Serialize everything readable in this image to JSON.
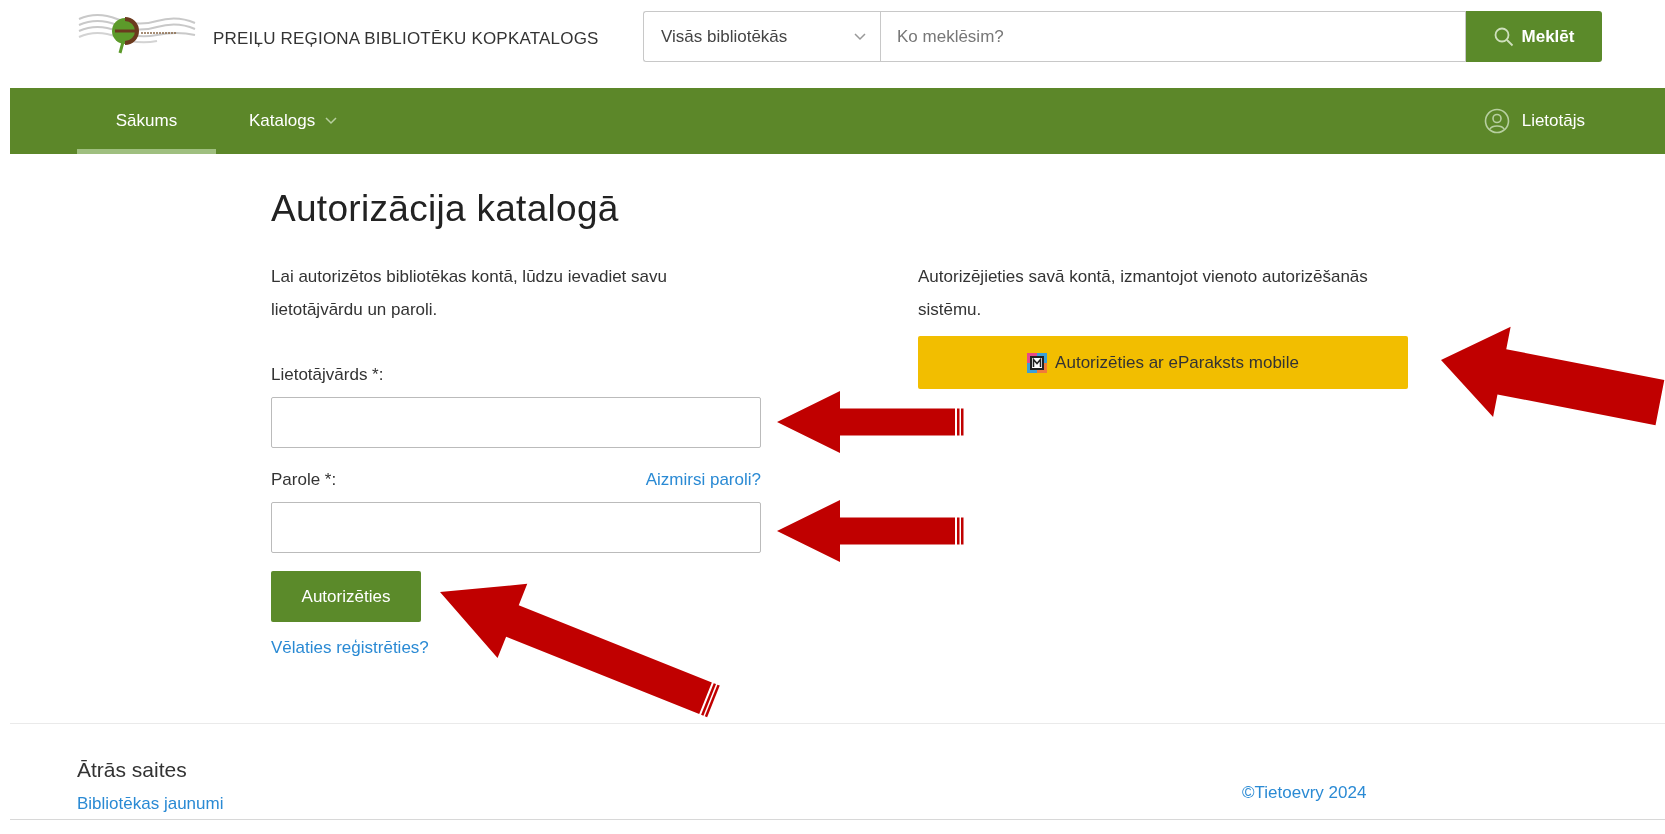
{
  "header": {
    "title": "PREIĻU REĢIONA BIBLIOTĒKU KOPKATALOGS",
    "search": {
      "scope": "Visās bibliotēkās",
      "placeholder": "Ko meklēsim?",
      "button": "Meklēt"
    }
  },
  "nav": {
    "items": [
      {
        "label": "Sākums",
        "selected": true,
        "dropdown": false
      },
      {
        "label": "Katalogs",
        "selected": false,
        "dropdown": true
      }
    ],
    "user": "Lietotājs"
  },
  "login": {
    "title": "Autorizācija katalogā",
    "intro": "Lai autorizētos bibliotēkas kontā, lūdzu ievadiet savu lietotājvārdu un paroli.",
    "fields": [
      {
        "label": "Lietotājvārds *:"
      },
      {
        "label": "Parole *:",
        "link": "Aizmirsi paroli?"
      }
    ],
    "submit": "Autorizēties",
    "register_link": "Vēlaties reģistrēties?"
  },
  "sso": {
    "text": "Autorizējieties savā kontā, izmantojot vienoto autorizēšanās sistēmu.",
    "button": "Autorizēties ar eParaksts mobile"
  },
  "footer": {
    "heading": "Ātrās saites",
    "links": [
      "Bibliotēkas jaunumi"
    ],
    "copyright": "©Tietoevry 2024"
  }
}
